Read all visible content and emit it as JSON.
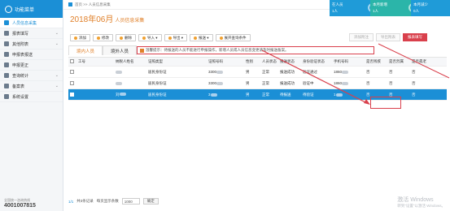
{
  "sidebar": {
    "title": "功能菜单",
    "items": [
      {
        "label": "人员信息采集",
        "active": true,
        "chevron": false
      },
      {
        "label": "报表填写",
        "active": false,
        "chevron": true
      },
      {
        "label": "其他附表",
        "active": false,
        "chevron": true
      },
      {
        "label": "申报表报送",
        "active": false,
        "chevron": false
      },
      {
        "label": "申报更正",
        "active": false,
        "chevron": false
      },
      {
        "label": "查询统计",
        "active": false,
        "chevron": true
      },
      {
        "label": "备案表",
        "active": false,
        "chevron": true
      },
      {
        "label": "系统设置",
        "active": false,
        "chevron": false
      }
    ],
    "hotline_label": "全国统一咨询热线",
    "hotline": "4001007815"
  },
  "breadcrumb": "首页 >> 人员信息采集",
  "title": {
    "main": "2018年06月",
    "sub": "人员信息采集"
  },
  "stats": [
    {
      "label": "在人员",
      "value": "1人"
    },
    {
      "label": "本月新增",
      "value": "1人"
    },
    {
      "label": "本月减少",
      "value": "0人"
    }
  ],
  "right_buttons": [
    "添加附注",
    "导出附表",
    "报表填写"
  ],
  "toolbar": [
    "添加",
    "修改",
    "删除",
    "导入 ▾",
    "导出 ▾",
    "报送 ▾",
    "展开查询条件"
  ],
  "tabs": [
    "境内人员",
    "境外人员"
  ],
  "tip": "温馨提示：待报送的人员不能进行申报操作，新增人员或人员信息变更请及时报送备案。",
  "columns": [
    "工号",
    "纳税人姓名",
    "证照类型",
    "证照号码",
    "性别",
    "人员状态",
    "报送状态",
    "身份验证状态",
    "手机号码",
    "是否残疾",
    "是否烈属",
    "是否孤老"
  ],
  "rows": [
    {
      "selected": false,
      "id_type": "居民身份证",
      "id_no": "3300",
      "gender": "男",
      "status": "正常",
      "report": "报送成功",
      "verify": "验证通过",
      "phone": "1860",
      "d": "否",
      "m": "否",
      "o": "否"
    },
    {
      "selected": false,
      "id_type": "居民身份证",
      "id_no": "3300",
      "gender": "男",
      "status": "正常",
      "report": "报送成功",
      "verify": "验证中",
      "phone": "1860",
      "d": "否",
      "m": "否",
      "o": "否"
    },
    {
      "selected": true,
      "name_prefix": "刘",
      "id_type": "居民身份证",
      "id_no": "3",
      "gender": "男",
      "status": "正常",
      "report": "待报送",
      "verify": "待验证",
      "phone": "1",
      "d": "否",
      "m": "否",
      "o": "否"
    }
  ],
  "pager": {
    "page": "1/1",
    "label1": "共3条记录",
    "label2": "每页显示条数",
    "per_page": "1000",
    "ok": "确定"
  },
  "watermark": {
    "line1": "激活 Windows",
    "line2": "转到\"设置\"以激活 Windows。"
  },
  "colors": {
    "accent": "#1b8fd6",
    "title": "#e0802a",
    "alert": "#d9404c"
  }
}
